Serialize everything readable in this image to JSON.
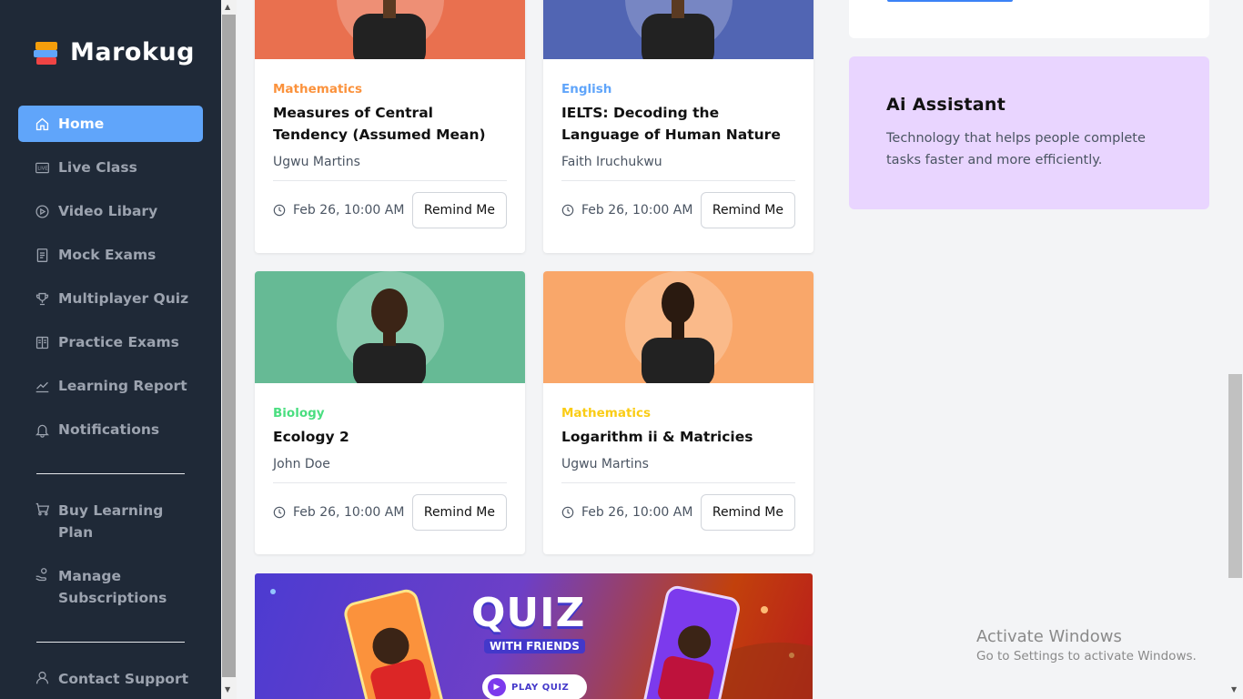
{
  "app": {
    "name": "Marokug"
  },
  "sidebar": {
    "items": [
      {
        "label": "Home",
        "icon": "home-icon",
        "active": true
      },
      {
        "label": "Live Class",
        "icon": "live-icon"
      },
      {
        "label": "Video Libary",
        "icon": "video-icon"
      },
      {
        "label": "Mock Exams",
        "icon": "document-icon"
      },
      {
        "label": "Multiplayer Quiz",
        "icon": "trophy-icon"
      },
      {
        "label": "Practice Exams",
        "icon": "book-icon"
      },
      {
        "label": "Learning Report",
        "icon": "chart-icon"
      },
      {
        "label": "Notifications",
        "icon": "bell-icon"
      }
    ],
    "buy_plan": {
      "line1": "Buy Learning",
      "line2": "Plan",
      "icon": "cart-icon"
    },
    "manage_subs": {
      "line1": "Manage",
      "line2": "Subscriptions",
      "icon": "hand-coin-icon"
    },
    "contact": {
      "label": "Contact Support",
      "icon": "support-icon"
    }
  },
  "classes": [
    {
      "subject": "Mathematics",
      "subject_color": "#fb923c",
      "title_line1": "Measures of Central",
      "title_line2": "Tendency (Assumed Mean)",
      "tutor": "Ugwu Martins",
      "time": "Feb 26, 10:00 AM",
      "button": "Remind Me",
      "bg": "#e9704f"
    },
    {
      "subject": "English",
      "subject_color": "#60a5fa",
      "title_line1": "IELTS: Decoding the",
      "title_line2": "Language of Human Nature",
      "tutor": "Faith Iruchukwu",
      "time": "Feb 26, 10:00 AM",
      "button": "Remind Me",
      "bg": "#5165b3"
    },
    {
      "subject": "Biology",
      "subject_color": "#4ade80",
      "title_line1": "Ecology 2",
      "tutor": "John Doe",
      "time": "Feb 26, 10:00 AM",
      "button": "Remind Me",
      "bg": "#66ba95"
    },
    {
      "subject": "Mathematics",
      "subject_color": "#facc15",
      "title_line1": "Logarithm ii & Matricies",
      "tutor": "Ugwu Martins",
      "time": "Feb 26, 10:00 AM",
      "button": "Remind Me",
      "bg": "#f9a76a"
    }
  ],
  "banner": {
    "title": "QUIZ",
    "subtitle": "WITH FRIENDS",
    "button": "PLAY QUIZ"
  },
  "ai_assistant": {
    "title": "Ai Assistant",
    "desc_line1": "Technology that helps people complete",
    "desc_line2": "tasks faster and more efficiently."
  },
  "watermark": {
    "line1": "Activate Windows",
    "line2": "Go to Settings to activate Windows."
  }
}
